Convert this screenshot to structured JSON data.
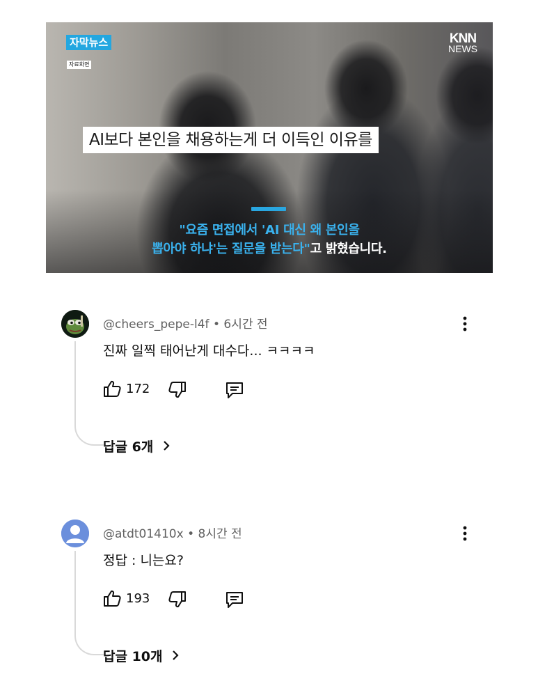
{
  "video": {
    "badge": "자막뉴스",
    "sublabel": "자료화면",
    "logo_top": "KNN",
    "logo_bottom": "NEWS",
    "caption": "AI보다 본인을 채용하는게 더 이득인 이유를",
    "quote_line1": "\"요즘 면접에서 'AI 대신 왜 본인을",
    "quote_line2_blue": "뽑아야 하냐'는 질문을 받는다\"",
    "quote_line2_white": "고 밝혔습니다."
  },
  "comments": [
    {
      "author": "@cheers_pepe-l4f",
      "time": "6시간 전",
      "text": "진짜 일찍 태어난게 대수다... ㅋㅋㅋㅋ",
      "likes": "172",
      "replies": "답글 6개"
    },
    {
      "author": "@atdt01410x",
      "time": "8시간 전",
      "text": "정답 : 니는요?",
      "likes": "193",
      "replies": "답글 10개"
    }
  ],
  "icons": {
    "like": "thumbs-up-icon",
    "dislike": "thumbs-down-icon",
    "reply": "reply-comment-icon",
    "more": "more-vertical-icon",
    "chevron": "chevron-right-icon"
  },
  "colors": {
    "badge_bg": "#23a7e0",
    "quote_blue": "#3ab2ee",
    "default_avatar": "#6b8fdc",
    "meta_gray": "#606060"
  }
}
